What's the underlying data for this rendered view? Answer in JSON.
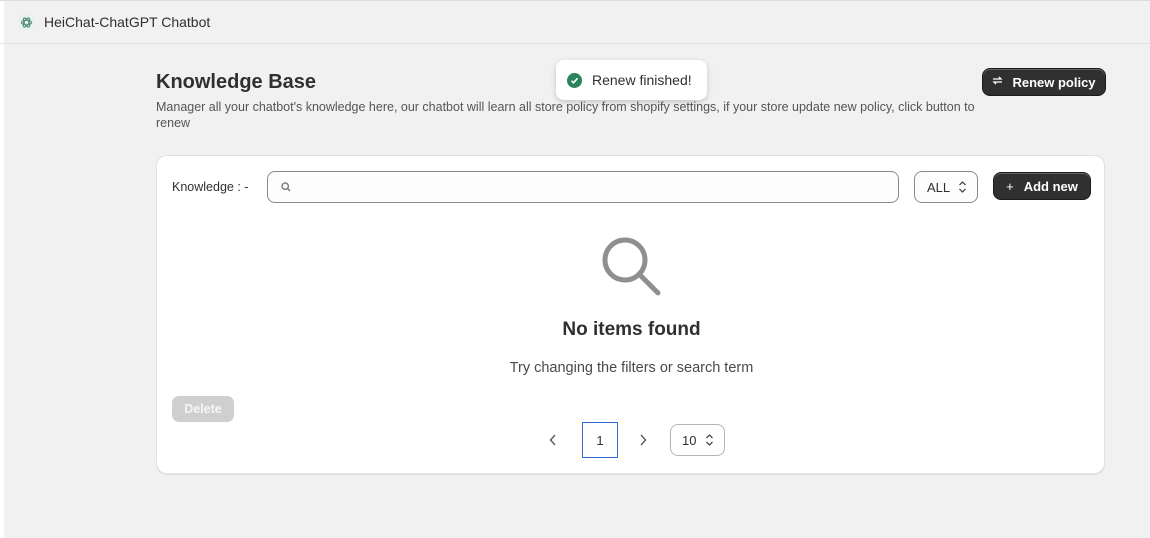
{
  "app": {
    "title": "HeiChat-ChatGPT Chatbot",
    "logo_icon": "openai-logo-icon"
  },
  "page": {
    "title": "Knowledge Base",
    "description": "Manager all your chatbot's knowledge here, our chatbot will learn all store policy from shopify settings, if your store update new policy, click button to renew",
    "renew_button_label": "Renew policy"
  },
  "toast": {
    "message": "Renew finished!",
    "status_color": "#29845a"
  },
  "knowledge": {
    "label": "Knowledge : -",
    "search_value": "",
    "search_placeholder": "",
    "filter_value": "ALL",
    "add_button_label": "Add new"
  },
  "empty_state": {
    "title": "No items found",
    "subtitle": "Try changing the filters or search term"
  },
  "actions": {
    "delete_label": "Delete"
  },
  "pagination": {
    "current_page": "1",
    "page_size": "10"
  },
  "colors": {
    "primary_button": "#303030",
    "background": "#f1f1f1",
    "focus_border": "#2c6ecb"
  }
}
